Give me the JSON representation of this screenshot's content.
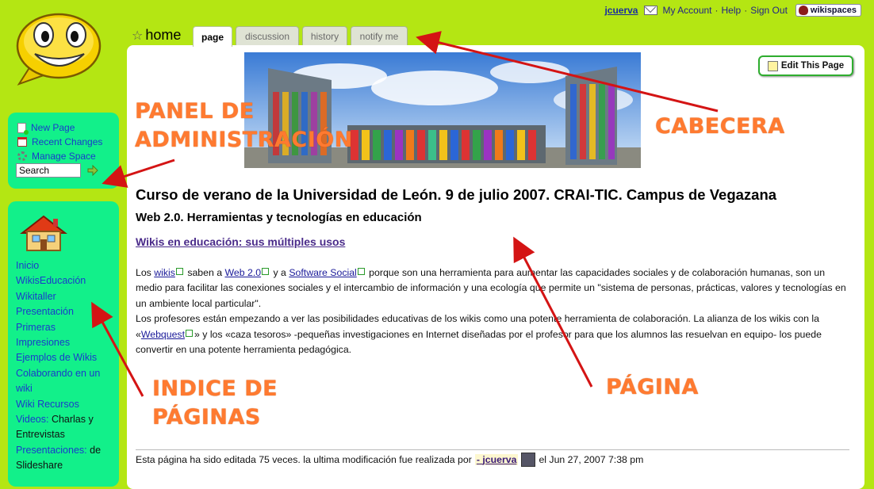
{
  "topbar": {
    "username": "jcuerva",
    "my_account": "My Account",
    "help": "Help",
    "sign_out": "Sign Out",
    "separator": "·",
    "badge": "wikispaces"
  },
  "admin": {
    "new_page": "New Page",
    "recent_changes": "Recent Changes",
    "manage_space": "Manage Space",
    "search_value": "Search"
  },
  "nav": {
    "items": [
      {
        "label": "Inicio"
      },
      {
        "label": "WikisEducación"
      },
      {
        "label": "Wikitaller"
      },
      {
        "label": "Presentación"
      },
      {
        "label": "Primeras"
      },
      {
        "label": "Impresiones"
      },
      {
        "label": "Ejemplos de Wikis"
      },
      {
        "label": "Colaborando en un"
      },
      {
        "label": "wiki"
      },
      {
        "label": "Wiki Recursos"
      },
      {
        "label": "Videos:",
        "rest": " Charlas y"
      },
      {
        "label": "Entrevistas",
        "plain": true
      },
      {
        "label": "Presentaciones:",
        "rest": " de"
      },
      {
        "label": "Slideshare",
        "plain": true
      }
    ]
  },
  "header": {
    "page_name": "home",
    "tabs": [
      "page",
      "discussion",
      "history",
      "notify me"
    ]
  },
  "page": {
    "edit_button": "Edit This Page",
    "title": "Curso de verano de la Universidad de León. 9 de julio 2007. CRAI-TIC. Campus de Vegazana",
    "subtitle": "Web 2.0. Herramientas y tecnologías en educación",
    "link": "Wikis en educación: sus múltiples usos",
    "p1_t1": "Los ",
    "p1_l1": "wikis",
    "p1_t2": " saben a ",
    "p1_l2": "Web 2.0",
    "p1_t3": " y a ",
    "p1_l3": "Software Social",
    "p1_t4": " porque son una herramienta para aumentar las capacidades sociales y de colaboración humanas, son un medio para facilitar las conexiones sociales y el intercambio de información y una ecología que permite un \"sistema de personas, prácticas, valores y tecnologías en un ambiente local particular\".",
    "p2_t1": "Los profesores están empezando a ver las posibilidades educativas de los wikis como una potente herramienta de colaboración. La alianza de los wikis con la «",
    "p2_l1": "Webquest",
    "p2_t2": "» y los «caza tesoros» -pequeñas investigaciones en Internet diseñadas por el profesor para que los alumnos las resuelvan en equipo- los puede convertir en una potente herramienta pedagógica.",
    "footer_pre": "Esta página ha sido editada 75 veces. la ultima modificación fue realizada por",
    "footer_dash": "-",
    "footer_user": "jcuerva",
    "footer_post": "el Jun 27, 2007 7:38 pm"
  },
  "annotations": {
    "panel_admin_1": "PANEL DE",
    "panel_admin_2": "ADMINISTRACIÓN",
    "cabecera": "CABECERA",
    "pagina": "PÁGINA",
    "indice_1": "INDICE DE",
    "indice_2": "PÁGINAS",
    "color": "#ff7a30",
    "arrow_color": "#d41414"
  },
  "colors": {
    "background": "#b4e613",
    "panel": "#12f08a",
    "link": "#1a3acc"
  }
}
